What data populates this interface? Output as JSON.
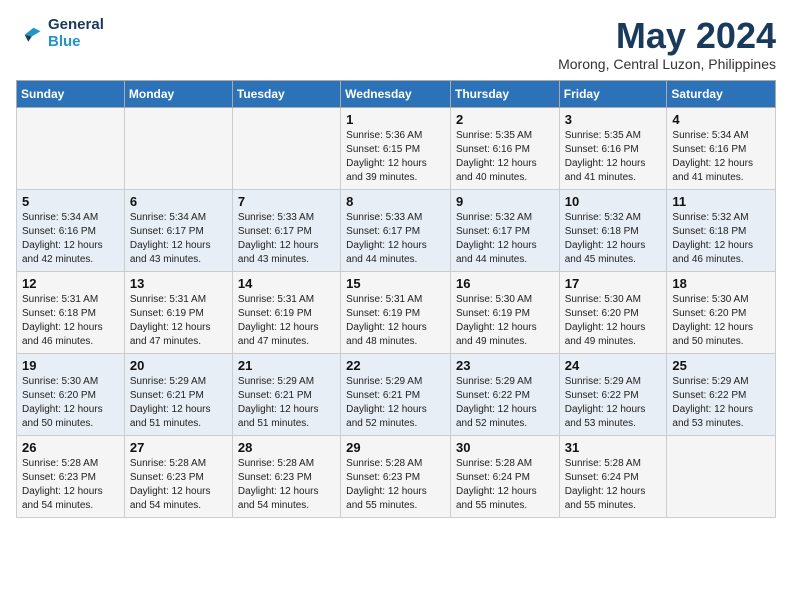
{
  "header": {
    "logo_line1": "General",
    "logo_line2": "Blue",
    "month_year": "May 2024",
    "location": "Morong, Central Luzon, Philippines"
  },
  "days_of_week": [
    "Sunday",
    "Monday",
    "Tuesday",
    "Wednesday",
    "Thursday",
    "Friday",
    "Saturday"
  ],
  "weeks": [
    [
      {
        "day": "",
        "info": ""
      },
      {
        "day": "",
        "info": ""
      },
      {
        "day": "",
        "info": ""
      },
      {
        "day": "1",
        "info": "Sunrise: 5:36 AM\nSunset: 6:15 PM\nDaylight: 12 hours\nand 39 minutes."
      },
      {
        "day": "2",
        "info": "Sunrise: 5:35 AM\nSunset: 6:16 PM\nDaylight: 12 hours\nand 40 minutes."
      },
      {
        "day": "3",
        "info": "Sunrise: 5:35 AM\nSunset: 6:16 PM\nDaylight: 12 hours\nand 41 minutes."
      },
      {
        "day": "4",
        "info": "Sunrise: 5:34 AM\nSunset: 6:16 PM\nDaylight: 12 hours\nand 41 minutes."
      }
    ],
    [
      {
        "day": "5",
        "info": "Sunrise: 5:34 AM\nSunset: 6:16 PM\nDaylight: 12 hours\nand 42 minutes."
      },
      {
        "day": "6",
        "info": "Sunrise: 5:34 AM\nSunset: 6:17 PM\nDaylight: 12 hours\nand 43 minutes."
      },
      {
        "day": "7",
        "info": "Sunrise: 5:33 AM\nSunset: 6:17 PM\nDaylight: 12 hours\nand 43 minutes."
      },
      {
        "day": "8",
        "info": "Sunrise: 5:33 AM\nSunset: 6:17 PM\nDaylight: 12 hours\nand 44 minutes."
      },
      {
        "day": "9",
        "info": "Sunrise: 5:32 AM\nSunset: 6:17 PM\nDaylight: 12 hours\nand 44 minutes."
      },
      {
        "day": "10",
        "info": "Sunrise: 5:32 AM\nSunset: 6:18 PM\nDaylight: 12 hours\nand 45 minutes."
      },
      {
        "day": "11",
        "info": "Sunrise: 5:32 AM\nSunset: 6:18 PM\nDaylight: 12 hours\nand 46 minutes."
      }
    ],
    [
      {
        "day": "12",
        "info": "Sunrise: 5:31 AM\nSunset: 6:18 PM\nDaylight: 12 hours\nand 46 minutes."
      },
      {
        "day": "13",
        "info": "Sunrise: 5:31 AM\nSunset: 6:19 PM\nDaylight: 12 hours\nand 47 minutes."
      },
      {
        "day": "14",
        "info": "Sunrise: 5:31 AM\nSunset: 6:19 PM\nDaylight: 12 hours\nand 47 minutes."
      },
      {
        "day": "15",
        "info": "Sunrise: 5:31 AM\nSunset: 6:19 PM\nDaylight: 12 hours\nand 48 minutes."
      },
      {
        "day": "16",
        "info": "Sunrise: 5:30 AM\nSunset: 6:19 PM\nDaylight: 12 hours\nand 49 minutes."
      },
      {
        "day": "17",
        "info": "Sunrise: 5:30 AM\nSunset: 6:20 PM\nDaylight: 12 hours\nand 49 minutes."
      },
      {
        "day": "18",
        "info": "Sunrise: 5:30 AM\nSunset: 6:20 PM\nDaylight: 12 hours\nand 50 minutes."
      }
    ],
    [
      {
        "day": "19",
        "info": "Sunrise: 5:30 AM\nSunset: 6:20 PM\nDaylight: 12 hours\nand 50 minutes."
      },
      {
        "day": "20",
        "info": "Sunrise: 5:29 AM\nSunset: 6:21 PM\nDaylight: 12 hours\nand 51 minutes."
      },
      {
        "day": "21",
        "info": "Sunrise: 5:29 AM\nSunset: 6:21 PM\nDaylight: 12 hours\nand 51 minutes."
      },
      {
        "day": "22",
        "info": "Sunrise: 5:29 AM\nSunset: 6:21 PM\nDaylight: 12 hours\nand 52 minutes."
      },
      {
        "day": "23",
        "info": "Sunrise: 5:29 AM\nSunset: 6:22 PM\nDaylight: 12 hours\nand 52 minutes."
      },
      {
        "day": "24",
        "info": "Sunrise: 5:29 AM\nSunset: 6:22 PM\nDaylight: 12 hours\nand 53 minutes."
      },
      {
        "day": "25",
        "info": "Sunrise: 5:29 AM\nSunset: 6:22 PM\nDaylight: 12 hours\nand 53 minutes."
      }
    ],
    [
      {
        "day": "26",
        "info": "Sunrise: 5:28 AM\nSunset: 6:23 PM\nDaylight: 12 hours\nand 54 minutes."
      },
      {
        "day": "27",
        "info": "Sunrise: 5:28 AM\nSunset: 6:23 PM\nDaylight: 12 hours\nand 54 minutes."
      },
      {
        "day": "28",
        "info": "Sunrise: 5:28 AM\nSunset: 6:23 PM\nDaylight: 12 hours\nand 54 minutes."
      },
      {
        "day": "29",
        "info": "Sunrise: 5:28 AM\nSunset: 6:23 PM\nDaylight: 12 hours\nand 55 minutes."
      },
      {
        "day": "30",
        "info": "Sunrise: 5:28 AM\nSunset: 6:24 PM\nDaylight: 12 hours\nand 55 minutes."
      },
      {
        "day": "31",
        "info": "Sunrise: 5:28 AM\nSunset: 6:24 PM\nDaylight: 12 hours\nand 55 minutes."
      },
      {
        "day": "",
        "info": ""
      }
    ]
  ]
}
